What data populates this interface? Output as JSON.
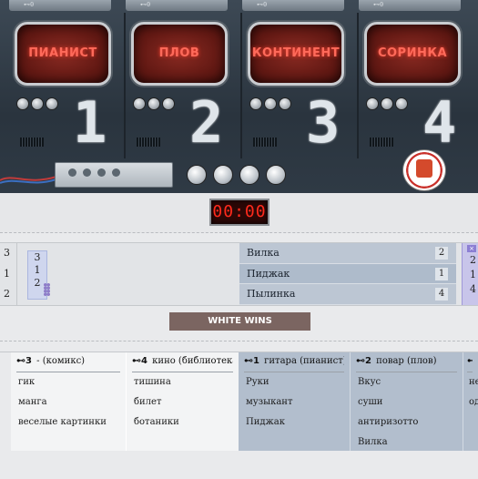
{
  "machine": {
    "rails": [
      "⊷0",
      "⊷0",
      "⊷0",
      "⊷0"
    ],
    "stations": [
      {
        "screen": "ПИАНИСТ",
        "number": "1"
      },
      {
        "screen": "ПЛОВ",
        "number": "2"
      },
      {
        "screen": "КОНТИНЕНТ",
        "number": "3"
      },
      {
        "screen": "СОРИНКА",
        "number": "4"
      }
    ]
  },
  "timer": {
    "value": "00:00"
  },
  "guess": {
    "left_numbers": [
      "3",
      "1",
      "2"
    ],
    "pick_numbers": [
      "3",
      "1",
      "2"
    ],
    "words": [
      {
        "word": "Вилка",
        "num": "2"
      },
      {
        "word": "Пиджак",
        "num": "1"
      },
      {
        "word": "Пылинка",
        "num": "4"
      }
    ],
    "right_card": {
      "close": "×",
      "numbers": [
        "2",
        "1",
        "4"
      ]
    }
  },
  "result": {
    "label": "WHITE WINS"
  },
  "clues": [
    {
      "key": "⊷3",
      "title": "- (комикс)",
      "items": [
        "гик",
        "манга",
        "веселые картинки"
      ],
      "tone": "light"
    },
    {
      "key": "⊷4",
      "title": "кино (библиотека)",
      "items": [
        "тишина",
        "билет",
        "ботаники"
      ],
      "tone": "light"
    },
    {
      "key": "⊷1",
      "title": "гитара (пианист)",
      "items": [
        "Руки",
        "музыкант",
        "Пиджак"
      ],
      "tone": "dark"
    },
    {
      "key": "⊷2",
      "title": "повар (плов)",
      "items": [
        "Вкус",
        "суши",
        "антиризотто",
        "Вилка"
      ],
      "tone": "dark"
    },
    {
      "key": "⊷",
      "title": "",
      "items": [
        "не",
        "од"
      ],
      "tone": "dark"
    }
  ],
  "colors": {
    "screen_text": "#ff6a5a",
    "timer_text": "#ff2a1c",
    "result_bg": "#7b6561"
  }
}
